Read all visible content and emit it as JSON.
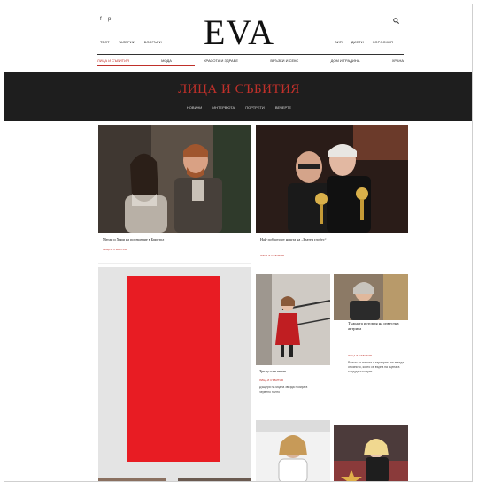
{
  "site": {
    "logo": "EVA",
    "social": [
      {
        "name": "facebook-icon",
        "glyph": "f"
      },
      {
        "name": "pinterest-icon",
        "glyph": "p"
      }
    ],
    "search_icon": "search-icon",
    "top_left_links": [
      "ТЕСТ",
      "ГАЛЕРИИ",
      "БЛОГЪРИ"
    ],
    "top_right_links": [
      "ВИП",
      "ДИЕТИ",
      "ХОРОСКОП"
    ]
  },
  "categories": [
    {
      "label": "ЛИЦА И СЪБИТИЯ",
      "active": true
    },
    {
      "label": "МОДА",
      "active": false
    },
    {
      "label": "КРАСОТА И ЗДРАВЕ",
      "active": false
    },
    {
      "label": "ВРЪЗКИ И СЕКС",
      "active": false
    },
    {
      "label": "ДОМ И ГРАДИНА",
      "active": false
    },
    {
      "label": "ХРАНА",
      "active": false
    }
  ],
  "section": {
    "title": "ЛИЦА И СЪБИТИЯ",
    "subnav": [
      "НОВИНИ",
      "ИНТЕРВЮТА",
      "ПОРТРЕТИ",
      "ВЕЧЕРТЕ"
    ]
  },
  "articles": [
    {
      "title": "Меган и Хари на посещение в Бристол",
      "tag": "ЛИЦА И СЪБИТИЯ"
    },
    {
      "title": "Най-доброто от нощта на „Златен глобус“",
      "tag": "ЛИЦА И СЪБИТИЯ"
    },
    {
      "title": "Три детски визии",
      "tag": "ЛИЦА И СЪБИТИЯ",
      "excerpt": "Дъщеря на модна звезда позира в червено палто"
    },
    {
      "title": "Тъжната история на известна актриса",
      "tag": "ЛИЦА И СЪБИТИЯ",
      "excerpt": "Разказ за живота и кариерата на звезда от киното, която се върна на сцената след дълга пауза"
    }
  ],
  "colors": {
    "accent": "#c0302a",
    "ad_block": "#e81c23",
    "band": "#1e1e1e"
  }
}
